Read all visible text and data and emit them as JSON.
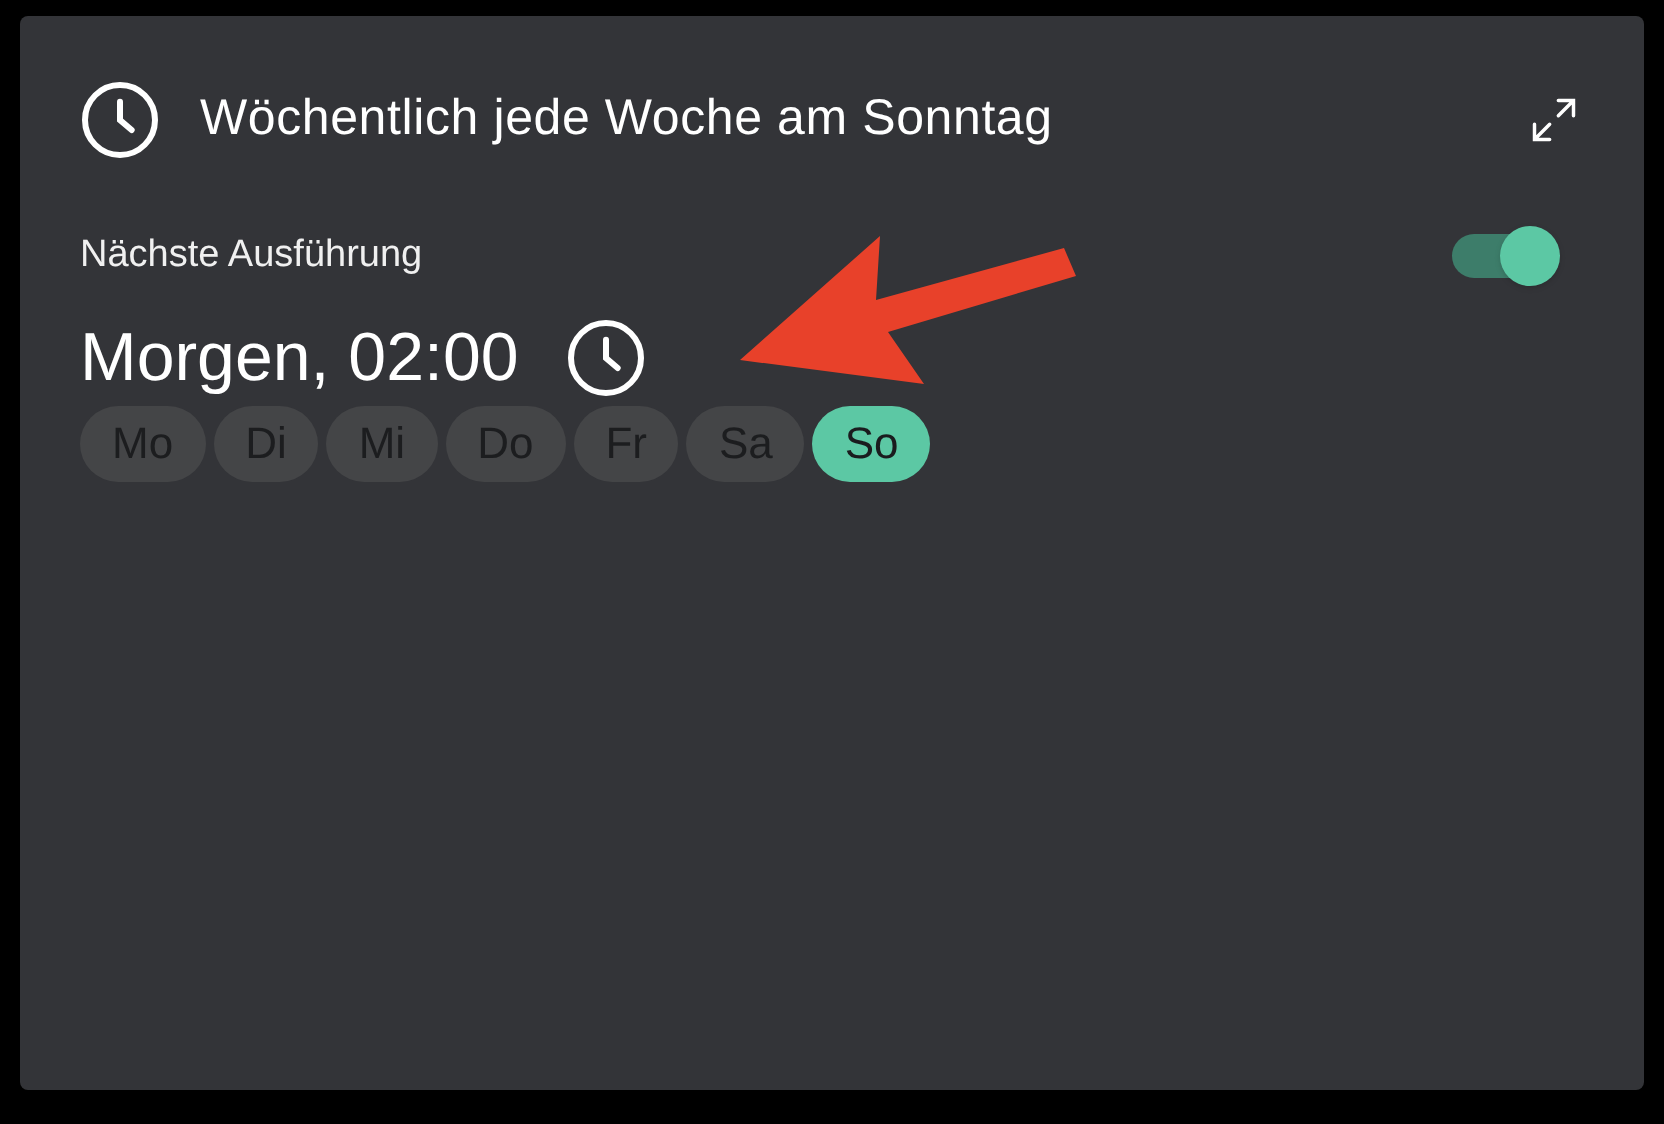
{
  "card": {
    "title": "Wöchentlich jede Woche am Sonntag",
    "next_run_label": "Nächste Ausführung",
    "enabled": {
      "on": true
    },
    "next_run": "Morgen, 02:00",
    "days": [
      {
        "label": "Mo",
        "selected": false
      },
      {
        "label": "Di",
        "selected": false
      },
      {
        "label": "Mi",
        "selected": false
      },
      {
        "label": "Do",
        "selected": false
      },
      {
        "label": "Fr",
        "selected": false
      },
      {
        "label": "Sa",
        "selected": false
      },
      {
        "label": "So",
        "selected": true
      }
    ]
  }
}
